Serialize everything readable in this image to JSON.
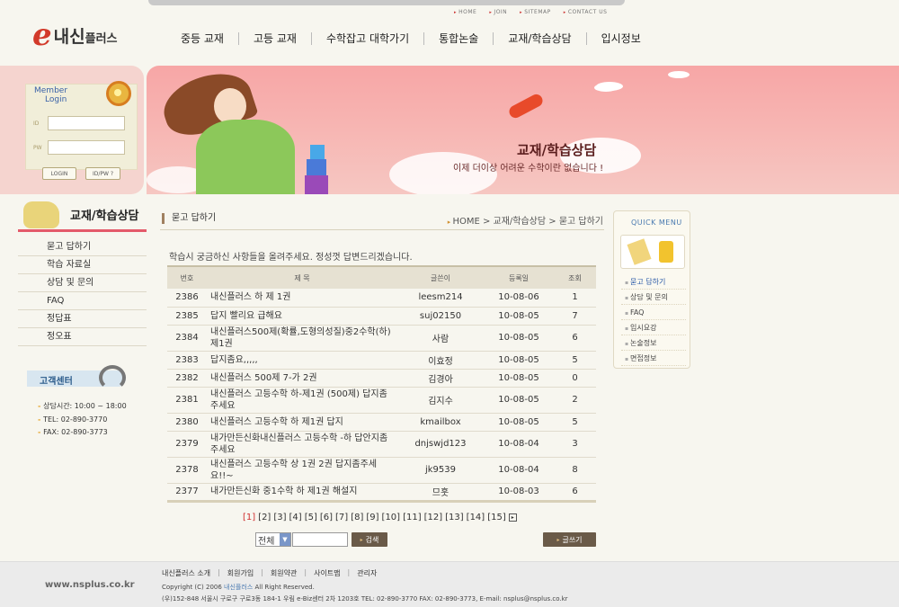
{
  "util_links": [
    "HOME",
    "JOIN",
    "SITEMAP",
    "CONTACT US"
  ],
  "logo": {
    "e": "e",
    "main": "내신",
    "small": "플러스"
  },
  "nav": [
    "중등 교재",
    "고등 교재",
    "수학잡고 대학가기",
    "통합논술",
    "교재/학습상담",
    "입시정보"
  ],
  "login": {
    "member_label": "Member",
    "login_label": "Login",
    "id_label": "ID",
    "pw_label": "PW",
    "login_button": "LOGIN",
    "idpw_button": "ID/PW ?"
  },
  "hero": {
    "title": "교재/학습상담",
    "subtitle": "이제 더이상 어려운 수학이란 없습니다 !"
  },
  "sidebar": {
    "title": "교재/학습상담",
    "items": [
      "묻고 답하기",
      "학습 자료실",
      "상담 및 문의",
      "FAQ",
      "정답표",
      "정오표"
    ]
  },
  "customer_center": {
    "title": "고객센터",
    "hours": "상담시간: 10:00 ~ 18:00",
    "tel": "TEL: 02-890-3770",
    "fax": "FAX: 02-890-3773"
  },
  "page": {
    "title": "묻고 답하기",
    "breadcrumb": "HOME > 교재/학습상담 > 묻고 답하기",
    "intro": "학습시 궁금하신 사항들을 올려주세요. 정성껏 답변드리겠습니다."
  },
  "table": {
    "headers": [
      "번호",
      "제    목",
      "글쓴이",
      "등록일",
      "조회"
    ],
    "rows": [
      {
        "no": "2386",
        "title": "내신플러스 하 제 1권",
        "author": "leesm214",
        "date": "10-08-06",
        "views": "1"
      },
      {
        "no": "2385",
        "title": "답지 빨리요 급해요",
        "author": "suj02150",
        "date": "10-08-05",
        "views": "7"
      },
      {
        "no": "2384",
        "title": "내신플러스500제(확률,도형의성질)중2수학(하)제1권",
        "author": "사람",
        "date": "10-08-05",
        "views": "6"
      },
      {
        "no": "2383",
        "title": "답지좀요,,,,,",
        "author": "이효정",
        "date": "10-08-05",
        "views": "5"
      },
      {
        "no": "2382",
        "title": "내신플러스 500제 7-가 2권",
        "author": "김경아",
        "date": "10-08-05",
        "views": "0"
      },
      {
        "no": "2381",
        "title": "내신플러스 고등수학 하-제1권 (500제) 답지좀 주세요",
        "author": "김지수",
        "date": "10-08-05",
        "views": "2"
      },
      {
        "no": "2380",
        "title": "내신플러스 고등수학 하 제1권 답지",
        "author": "kmailbox",
        "date": "10-08-05",
        "views": "5"
      },
      {
        "no": "2379",
        "title": "내가만든신화내신플러스 고등수학 -하 답안지좀 주세요",
        "author": "dnjswjd123",
        "date": "10-08-04",
        "views": "3"
      },
      {
        "no": "2378",
        "title": "내신플러스 고등수학 상 1권 2권 답지좀주세요!!~",
        "author": "jk9539",
        "date": "10-08-04",
        "views": "8"
      },
      {
        "no": "2377",
        "title": "내가만든신화 중1수학 하 제1권 해설지",
        "author": "므훗",
        "date": "10-08-03",
        "views": "6"
      }
    ]
  },
  "pagination": [
    "[1]",
    "[2]",
    "[3]",
    "[4]",
    "[5]",
    "[6]",
    "[7]",
    "[8]",
    "[9]",
    "[10]",
    "[11]",
    "[12]",
    "[13]",
    "[14]",
    "[15]"
  ],
  "search": {
    "select_value": "전체",
    "search_button": "검색",
    "write_button": "글쓰기"
  },
  "quick_menu": {
    "title": "QUICK MENU",
    "items": [
      "묻고 답하기",
      "상담 및 문의",
      "FAQ",
      "입시요강",
      "논술정보",
      "면접정보"
    ]
  },
  "footer": {
    "url": "www.nsplus.co.kr",
    "links": [
      "내신플러스 소개",
      "회원가입",
      "회원약관",
      "사이트맵",
      "관리자"
    ],
    "copy_prefix": "Copyright (C) 2006 ",
    "copy_brand": "내신플러스",
    "copy_suffix": " All Right Reserved.",
    "address": "(우)152-848 서울시 구로구 구로3동 184-1 우림 e-Biz센터 2차 1203호   TEL: 02-890-3770 FAX: 02-890-3773, E-mail: nsplus@nsplus.co.kr"
  }
}
